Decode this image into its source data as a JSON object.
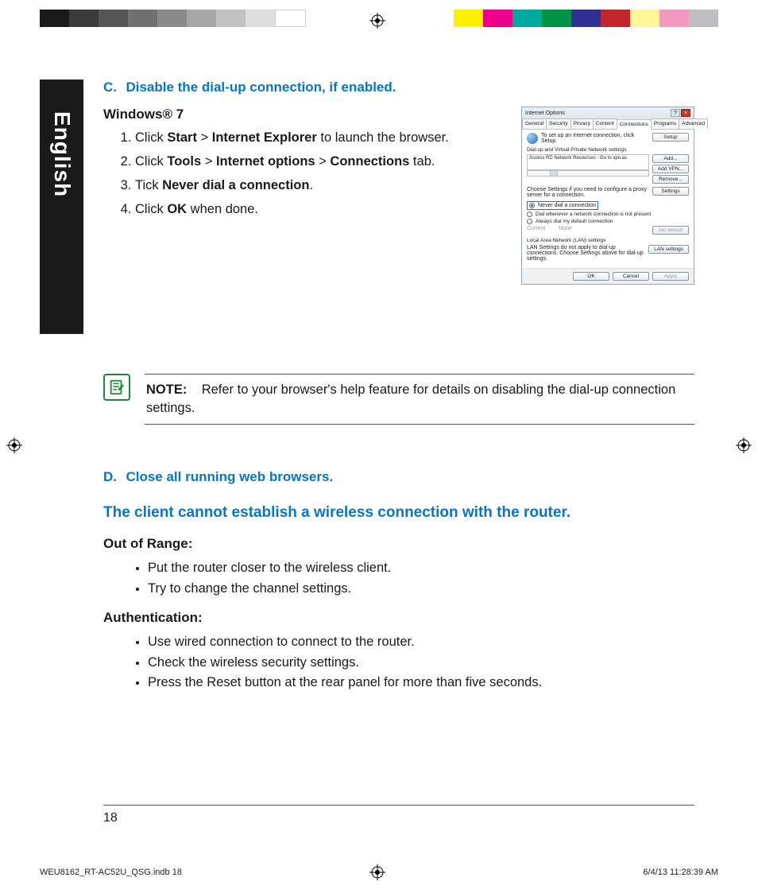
{
  "language_tab": "English",
  "section_c": {
    "letter": "C.",
    "title": "Disable the dial-up connection, if enabled.",
    "os_heading": "Windows® 7",
    "steps": [
      {
        "pre": "Click ",
        "b1": "Start",
        "mid": " > ",
        "b2": "Internet Explorer",
        "post": " to launch the browser."
      },
      {
        "pre": "Click ",
        "b1": "Tools",
        "mid1": " > ",
        "b2": "Internet options",
        "mid2": " > ",
        "b3": "Connections",
        "post": " tab."
      },
      {
        "pre": "Tick ",
        "b1": "Never dial a connection",
        "post": "."
      },
      {
        "pre": "Click ",
        "b1": "OK",
        "post": " when done."
      }
    ]
  },
  "dialog": {
    "title": "Internet Options",
    "tabs": [
      "General",
      "Security",
      "Privacy",
      "Content",
      "Connections",
      "Programs",
      "Advanced"
    ],
    "setup_text": "To set up an Internet connection, click Setup.",
    "btn_setup": "Setup",
    "group_dialup": "Dial-up and Virtual Private Network settings",
    "list_item": "Access RD Network Resources - Go to vpn.as",
    "btn_add": "Add...",
    "btn_add_vpn": "Add VPN...",
    "btn_remove": "Remove...",
    "proxy_text": "Choose Settings if you need to configure a proxy server for a connection.",
    "btn_settings": "Settings",
    "radio_never": "Never dial a connection",
    "radio_whenever": "Dial whenever a network connection is not present",
    "radio_always": "Always dial my default connection",
    "current_label": "Current",
    "current_none": "None",
    "btn_set_default": "Set default",
    "group_lan": "Local Area Network (LAN) settings",
    "lan_text": "LAN Settings do not apply to dial-up connections. Choose Settings above for dial-up settings.",
    "btn_lan": "LAN settings",
    "btn_ok": "OK",
    "btn_cancel": "Cancel",
    "btn_apply": "Apply"
  },
  "note": {
    "label": "NOTE:",
    "text": "Refer to your browser's help feature for details on disabling the dial-up connection settings."
  },
  "section_d": {
    "letter": "D.",
    "title": "Close all running web browsers."
  },
  "trouble": {
    "heading": "The client cannot establish a wireless connection with the router.",
    "out_of_range": {
      "title": "Out of Range:",
      "items": [
        "Put the router closer to the wireless client.",
        "Try to change the channel settings."
      ]
    },
    "auth": {
      "title": "Authentication:",
      "items": [
        "Use wired connection to connect to the router.",
        "Check the wireless security settings.",
        "Press the Reset button at the rear panel for more than five seconds."
      ]
    }
  },
  "page_number": "18",
  "imprint": {
    "file": "WEU8162_RT-AC52U_QSG.indb   18",
    "datetime": "6/4/13   11:28:39 AM"
  },
  "reg_colors_left": [
    "#1a1a1a",
    "#3a3a3a",
    "#555",
    "#707070",
    "#8a8a8a",
    "#a6a6a6",
    "#c2c2c2",
    "#dedede",
    "#ffffff"
  ],
  "reg_colors_right": [
    "#fff200",
    "#ec008c",
    "#00a99d",
    "#009245",
    "#2e3192",
    "#c1272d",
    "#fff799",
    "#f49ac1",
    "#bcbec0"
  ]
}
